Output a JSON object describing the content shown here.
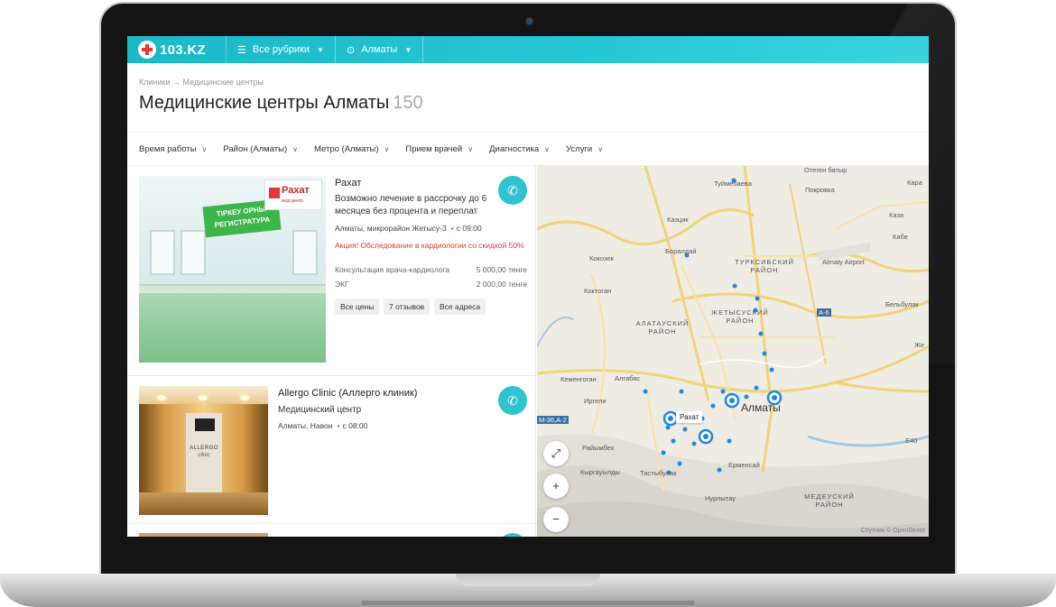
{
  "header": {
    "logo": "103.KZ",
    "rubrics": "Все рубрики",
    "city": "Алматы"
  },
  "breadcrumb": {
    "parent": "Клиники",
    "separator": "→",
    "current": "Медицинские центры"
  },
  "page": {
    "title": "Медицинские центры Алматы",
    "count": "150"
  },
  "filters": [
    "Время работы",
    "Район (Алматы)",
    "Метро (Алматы)",
    "Прием врачей",
    "Диагностика",
    "Услуги"
  ],
  "clinics": [
    {
      "name": "Рахат",
      "description": "Возможно лечение в рассрочку до 6 месяцев без процента и переплат",
      "address": "Алматы, микрорайон Жетысу-3",
      "hours": "с 09:00",
      "promo": "Акция! Обследование в кардиологии со скидкой 50%",
      "prices": [
        {
          "service": "Консультация врача-кардиолога",
          "price": "5 000,00 тенге"
        },
        {
          "service": "ЭКГ",
          "price": "2 000,00 тенге"
        }
      ],
      "buttons": [
        "Все цены",
        "7 отзывов",
        "Все адреса"
      ],
      "photo_sign": "ТІРКЕУ ОРНЫ РЕГИСТРАТУРА",
      "photo_logo": "Рахат",
      "photo_logo_sub": "мед центр"
    },
    {
      "name": "Allergo Clinic (Аллерго клиник)",
      "description": "Медицинский центр",
      "address": "Алматы, Навои",
      "hours": "с 08:00",
      "photo_brand": "ALLERGO",
      "photo_brand_sub": "clinic"
    }
  ],
  "map": {
    "labels": {
      "otegen": "Отеген батыр",
      "tuimebaeva": "Туймебаева",
      "pokrovka": "Покровка",
      "kazykh": "Казцик",
      "boraldai": "Боралдай",
      "kokozek": "Кокозек",
      "koktogan": "Коктоган",
      "kemertogan": "Кеменгоган",
      "algabas": "Алгабас",
      "irgeli": "Иргели",
      "raiymbek": "Райымбек",
      "kyrgauldy": "Кыргауылды",
      "tastybulak": "Тастыбулак",
      "ermensai": "Ерменсай",
      "nurlytau": "Нурлытау",
      "belbulak": "Бельбулак",
      "almaty_airport": "Almaty Airport",
      "kaza": "Каза",
      "kabe": "Кабе",
      "kara": "Кара",
      "dzhe": "Же"
    },
    "districts": {
      "turksib": "ТУРКСИБСКИЙ РАЙОН",
      "zhetysu": "ЖЕТЫСУСКИЙ РАЙОН",
      "alatau": "АЛАТАУСКИЙ РАЙОН",
      "medeu": "МЕДЕУСКИЙ РАЙОН"
    },
    "city": "Алматы",
    "selected_label": "Рахат",
    "road_a6": "А-6",
    "road_m36": "М-36,А-2",
    "road_e40": "Е40",
    "copyright": "Спутник © OpenStreet"
  },
  "colors": {
    "topbar": "#27c8d6",
    "accent": "#2ec4cf",
    "promo": "#e53935",
    "map_marker": "#1e88e5"
  }
}
